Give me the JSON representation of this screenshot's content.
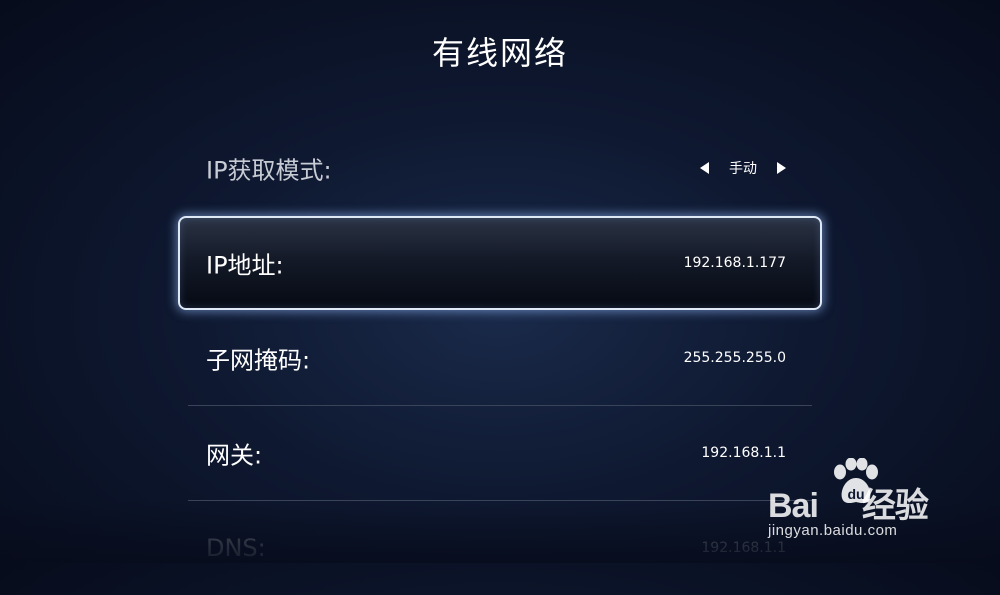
{
  "page": {
    "title": "有线网络"
  },
  "settings": [
    {
      "label": "IP获取模式:",
      "value": "手动"
    },
    {
      "label": "IP地址:",
      "value": "192.168.1.177"
    },
    {
      "label": "子网掩码:",
      "value": "255.255.255.0"
    },
    {
      "label": "网关:",
      "value": "192.168.1.1"
    },
    {
      "label": "DNS:",
      "value": "192.168.1.1"
    }
  ],
  "watermark": {
    "logo_left": "Bai",
    "logo_right": "经验",
    "url": "jingyan.baidu.com"
  },
  "colors": {
    "focus_border": "#dfe8f5",
    "background": "#0e1830",
    "divider": "#3a4458"
  },
  "icons": {
    "mode_prev": "arrow-left-icon",
    "mode_next": "arrow-right-icon",
    "watermark": "baidu-paw-icon"
  }
}
